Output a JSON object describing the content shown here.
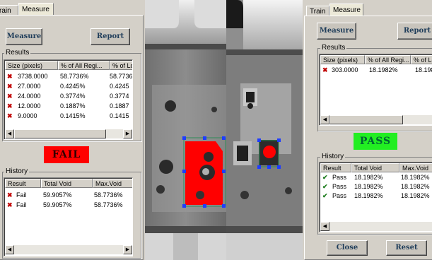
{
  "left": {
    "tabs": [
      "rain",
      "Measure"
    ],
    "measure_label": "Measure",
    "report_label": "Report",
    "results_label": "Results",
    "results_columns": [
      "Size (pixels)",
      "% of All Regi...",
      "% of Lo"
    ],
    "results_rows": [
      {
        "size": "3738.0000",
        "all": "58.7736%",
        "lo": "58.7736"
      },
      {
        "size": "27.0000",
        "all": "0.4245%",
        "lo": "0.4245"
      },
      {
        "size": "24.0000",
        "all": "0.3774%",
        "lo": "0.3774"
      },
      {
        "size": "12.0000",
        "all": "0.1887%",
        "lo": "0.1887"
      },
      {
        "size": "9.0000",
        "all": "0.1415%",
        "lo": "0.1415"
      }
    ],
    "status": "FAIL",
    "status_color": "#ff0000",
    "history_label": "History",
    "history_columns": [
      "Result",
      "Total Void",
      "Max.Void"
    ],
    "history_rows": [
      {
        "result": "Fail",
        "total": "59.9057%",
        "max": "58.7736%"
      },
      {
        "result": "Fail",
        "total": "59.9057%",
        "max": "58.7736%"
      }
    ]
  },
  "right": {
    "tabs": [
      "Train",
      "Measure"
    ],
    "measure_label": "Measure",
    "report_label": "Report",
    "results_label": "Results",
    "results_columns": [
      "Size (pixels)",
      "% of All Regi...",
      "% of Lo"
    ],
    "results_rows": [
      {
        "size": "303.0000",
        "all": "18.1982%",
        "lo": "18.198"
      }
    ],
    "status": "PASS",
    "status_color": "#22ee22",
    "history_label": "History",
    "history_columns": [
      "Result",
      "Total Void",
      "Max.Void"
    ],
    "history_rows": [
      {
        "result": "Pass",
        "total": "18.1982%",
        "max": "18.1982%"
      },
      {
        "result": "Pass",
        "total": "18.1982%",
        "max": "18.1982%"
      },
      {
        "result": "Pass",
        "total": "18.1982%",
        "max": "18.1982%"
      }
    ],
    "close_label": "Close",
    "reset_label": "Reset"
  },
  "icons": {
    "fail": "x-mark-icon",
    "pass": "check-mark-icon"
  },
  "highlight_color": "#ff0000",
  "selection_handle_color": "#1e3cff"
}
